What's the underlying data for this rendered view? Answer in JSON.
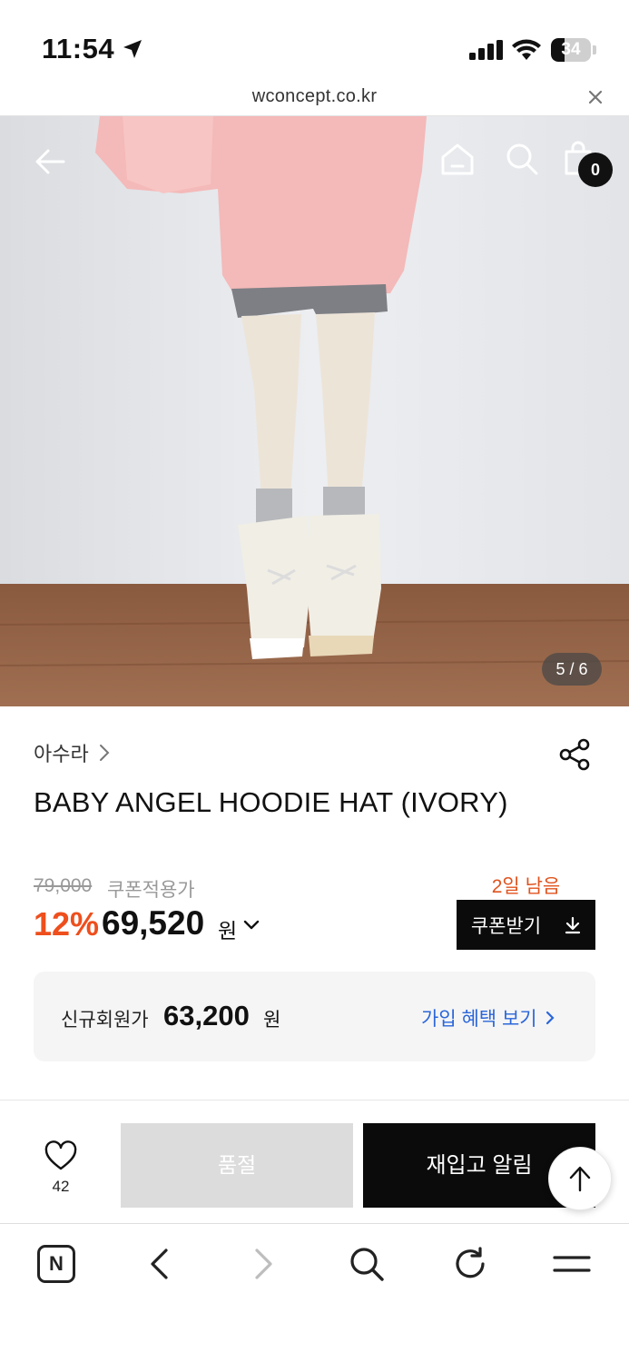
{
  "status_bar": {
    "time": "11:54",
    "battery": "34",
    "battery_level": 0.34
  },
  "browser": {
    "url": "wconcept.co.kr"
  },
  "gallery": {
    "counter": "5 / 6"
  },
  "header": {
    "cart_count": "0"
  },
  "product": {
    "brand": "아수라",
    "title": "BABY ANGEL HOODIE HAT (IVORY)",
    "original_price": "79,000",
    "coupon_label": "쿠폰적용가",
    "discount": "12%",
    "final_price": "69,520",
    "currency": "원",
    "days_left": "2일 남음",
    "coupon_button": "쿠폰받기"
  },
  "member": {
    "label": "신규회원가",
    "price": "63,200",
    "currency": "원",
    "link": "가입 혜택 보기"
  },
  "actions": {
    "like_count": "42",
    "soldout": "품절",
    "restock": "재입고 알림"
  },
  "toolbar": {
    "naver_label": "N"
  },
  "colors": {
    "accent_orange": "#ee4f1d",
    "link_blue": "#2b66d9",
    "black": "#0b0b0b",
    "soldout_gray": "#dcdcdc"
  },
  "icons": [
    "location-arrow-icon",
    "signal-icon",
    "wifi-icon",
    "battery-icon",
    "close-icon",
    "back-arrow-icon",
    "home-icon",
    "search-icon",
    "shopping-bag-icon",
    "chevron-right-icon",
    "share-icon",
    "chevron-down-icon",
    "download-icon",
    "heart-icon",
    "arrow-up-icon",
    "naver-icon",
    "browser-back-icon",
    "browser-forward-icon",
    "browser-search-icon",
    "reload-icon",
    "menu-icon"
  ]
}
